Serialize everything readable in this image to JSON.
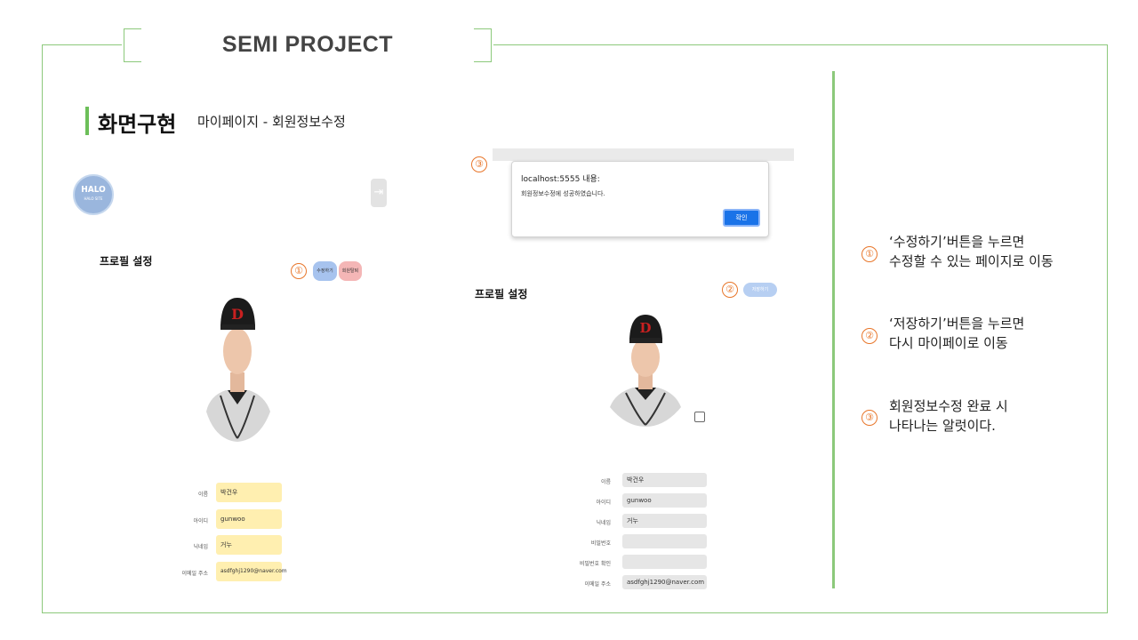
{
  "slide": {
    "title": "SEMI PROJECT"
  },
  "section": {
    "title": "화면구현",
    "subtitle": "마이페이지 - 회원정보수정"
  },
  "left_screen": {
    "logo_text": "HALO",
    "logo_sub": "HALO SITE",
    "logout_icon": "logout-icon",
    "profile_title": "프로필 설정",
    "marker": "①",
    "edit_button": "수정하기",
    "withdraw_button": "회원탈퇴",
    "fields": [
      {
        "label": "이름",
        "value": "박건우"
      },
      {
        "label": "아이디",
        "value": "gunwoo"
      },
      {
        "label": "닉네임",
        "value": "거누"
      },
      {
        "label": "이메일 주소",
        "value": "asdfghj1290@naver.com"
      }
    ]
  },
  "right_screen": {
    "marker_alert": "③",
    "alert_title": "localhost:5555 내용:",
    "alert_message": "회원정보수정에 성공하였습니다.",
    "alert_ok": "확인",
    "profile_title": "프로필 설정",
    "marker_save": "②",
    "save_button": "저장하기",
    "fields": [
      {
        "label": "이름",
        "value": "박건우"
      },
      {
        "label": "아이디",
        "value": "gunwoo"
      },
      {
        "label": "닉네임",
        "value": "거누"
      },
      {
        "label": "비밀번호",
        "value": ""
      },
      {
        "label": "비밀번호 확인",
        "value": ""
      },
      {
        "label": "이메일 주소",
        "value": "asdfghj1290@naver.com"
      }
    ]
  },
  "notes": [
    {
      "num": "①",
      "line1": "‘수정하기’버튼을 누르면",
      "line2": "수정할 수 있는 페이지로 이동"
    },
    {
      "num": "②",
      "line1": "‘저장하기’버튼을 누르면",
      "line2": "다시 마이페이로 이동"
    },
    {
      "num": "③",
      "line1": "회원정보수정 완료 시",
      "line2": "나타나는 알럿이다."
    }
  ],
  "colors": {
    "accent": "#8cc97b",
    "marker": "#e8762a",
    "alert_button": "#1a73e8"
  }
}
